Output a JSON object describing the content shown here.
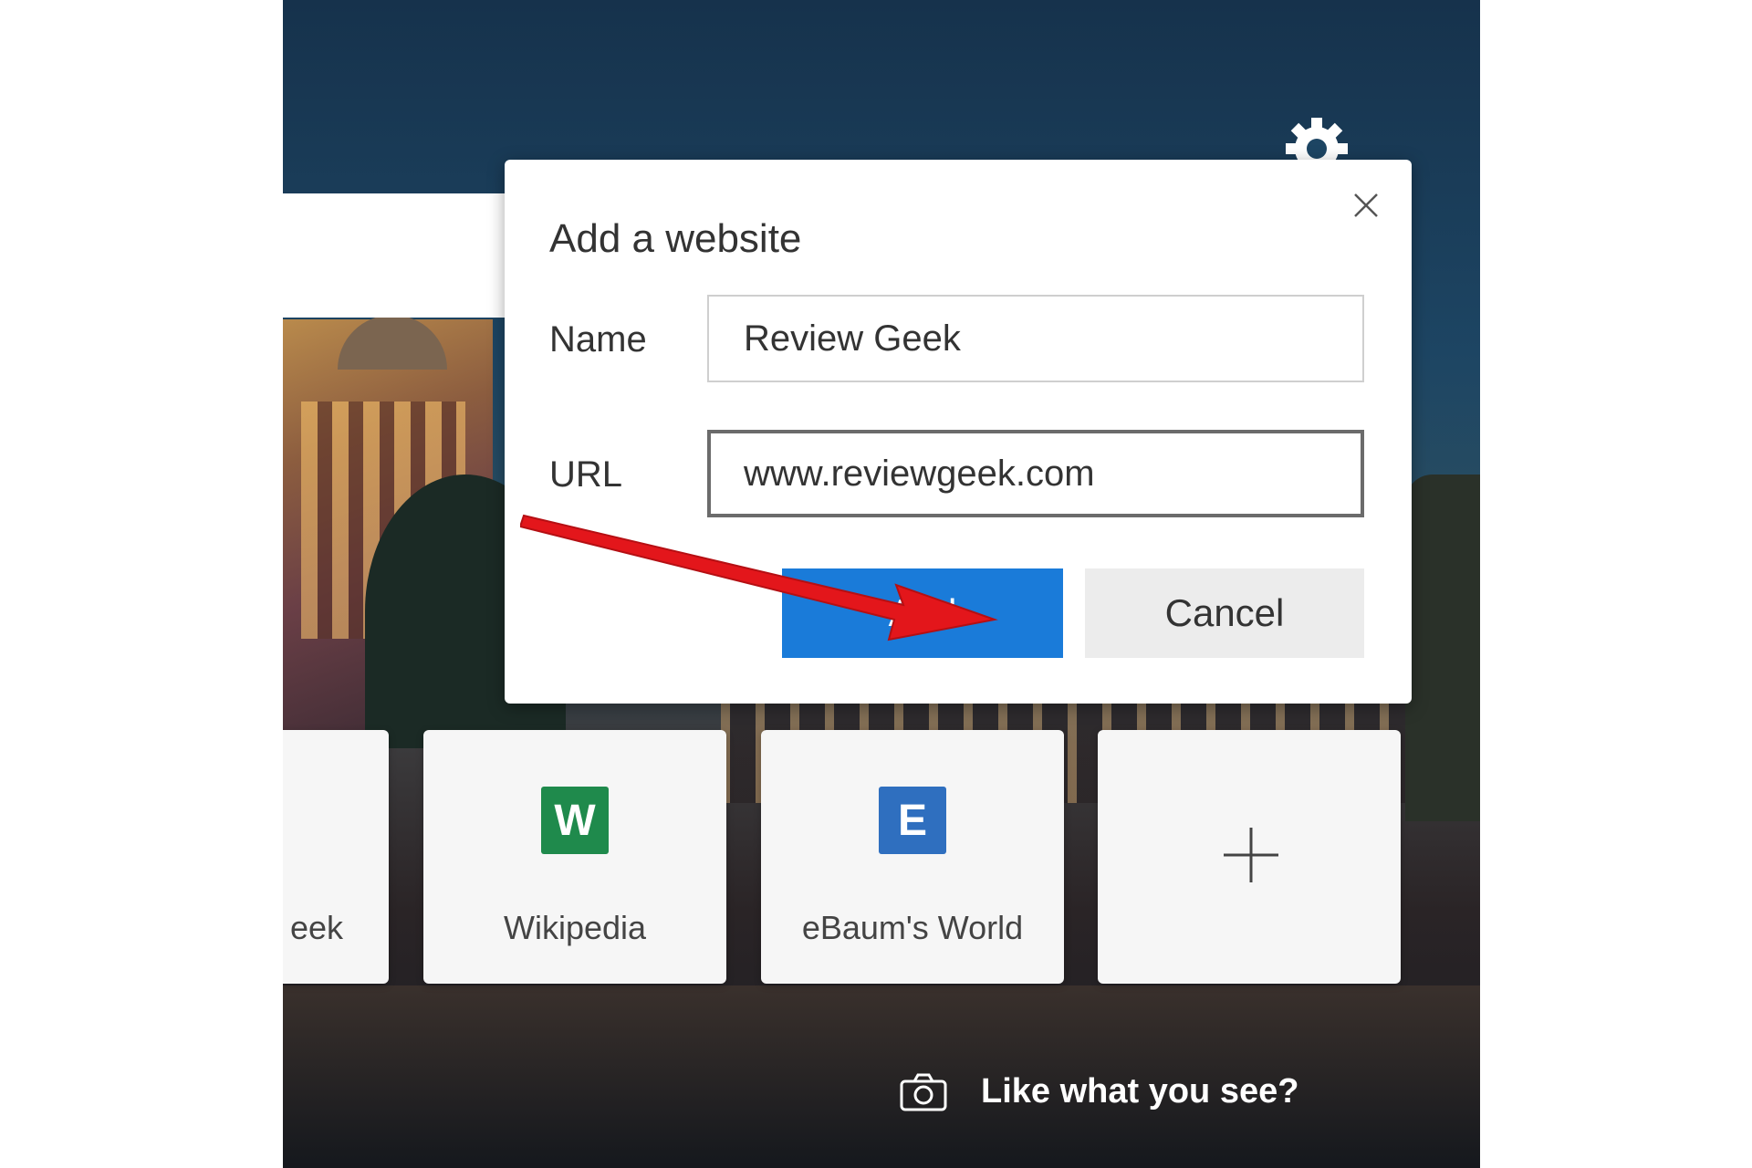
{
  "dialog": {
    "title": "Add a website",
    "close_icon": "close-icon",
    "name_label": "Name",
    "name_value": "Review Geek",
    "url_label": "URL",
    "url_value": "www.reviewgeek.com",
    "add_label": "Add",
    "cancel_label": "Cancel"
  },
  "top_sites": [
    {
      "label": "eek",
      "logo": ""
    },
    {
      "label": "Wikipedia",
      "logo": "W"
    },
    {
      "label": "eBaum's World",
      "logo": "E"
    },
    {
      "label": "",
      "icon": "plus-icon"
    }
  ],
  "settings_icon": "gear-icon",
  "footer": {
    "camera_icon": "camera-icon",
    "like_text": "Like what you see?"
  },
  "colors": {
    "accent": "#1a7bd9",
    "wikipedia": "#1f8a4c",
    "ebaum": "#2f6fbf",
    "annotation_arrow": "#e3161b"
  }
}
